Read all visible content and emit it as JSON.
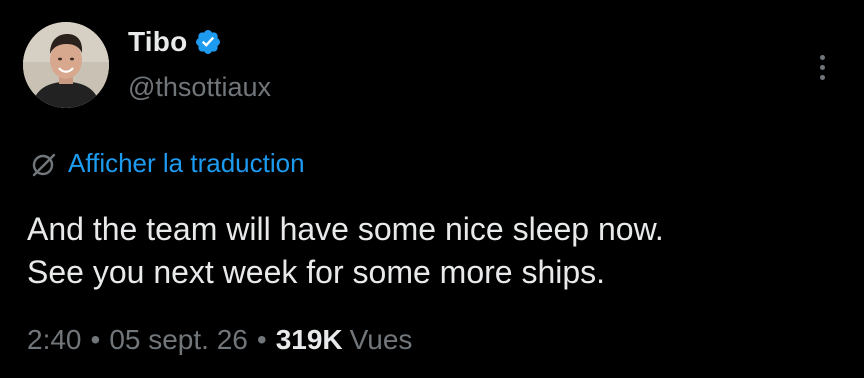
{
  "author": {
    "display_name": "Tibo",
    "handle": "@thsottiaux",
    "verified": true,
    "avatar_icon": "profile-photo"
  },
  "menu": {
    "icon": "more-vertical-icon"
  },
  "translation": {
    "label": "Afficher la traduction",
    "icon": "translate-globe-icon"
  },
  "tweet": {
    "lines": [
      "And the team will have some nice sleep now.",
      "See you next week for some more ships."
    ]
  },
  "meta": {
    "time": "2:40",
    "separator": "•",
    "date": "05 sept. 26",
    "views_count": "319K",
    "views_label": "Vues"
  },
  "colors": {
    "background": "#000000",
    "primary_text": "#e7e9ea",
    "secondary_text": "#71767b",
    "link": "#1d9bf0",
    "verified_badge": "#1d9bf0"
  }
}
